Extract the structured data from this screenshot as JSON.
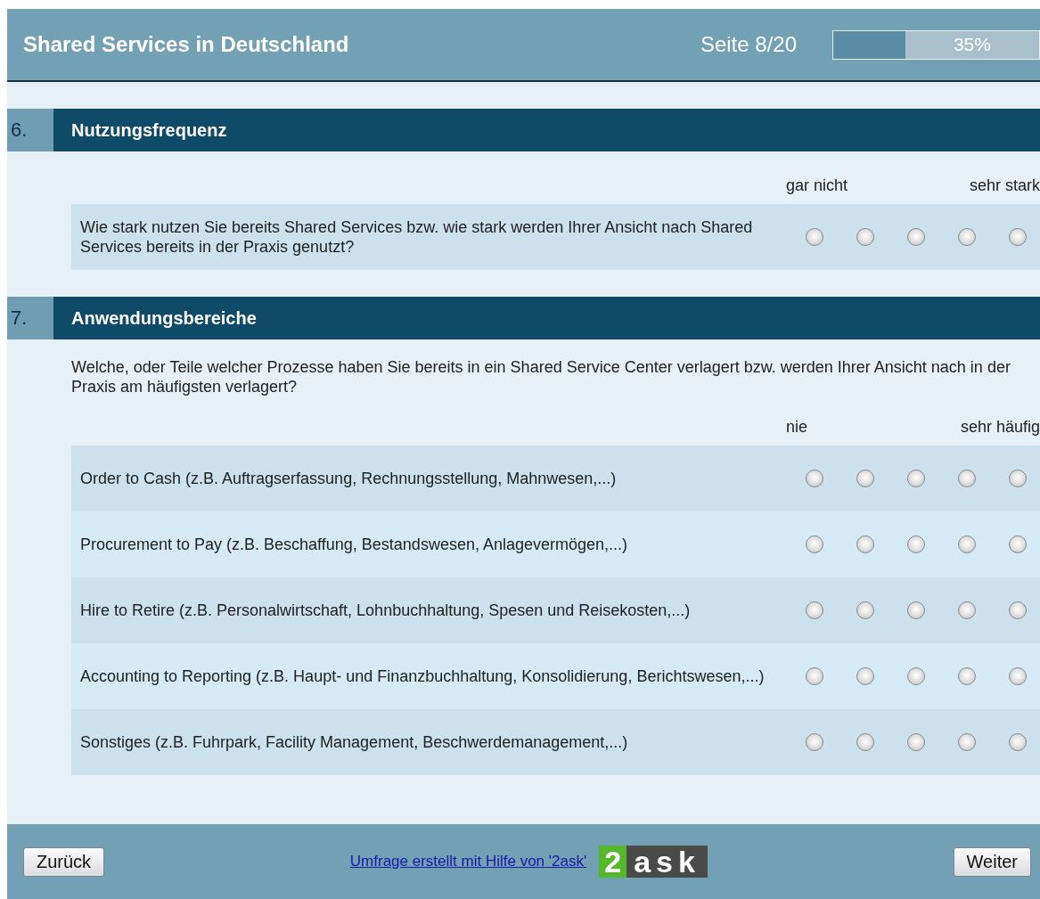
{
  "header": {
    "title": "Shared Services in Deutschland",
    "page": "Seite 8/20",
    "progress": {
      "level": 0.35,
      "reading": "35%"
    }
  },
  "sections": [
    {
      "number": "6.",
      "title": "Nutzungsfrequenz",
      "scale": {
        "low": "gar nicht",
        "high": "sehr stark"
      },
      "rows": [
        {
          "text": "Wie stark nutzen Sie bereits Shared Services bzw. wie stark werden Ihrer Ansicht nach Shared Services bereits in der Praxis genutzt?",
          "options": [
            {
              "selected": false
            },
            {
              "selected": false
            },
            {
              "selected": false
            },
            {
              "selected": false
            },
            {
              "selected": false
            }
          ]
        }
      ]
    },
    {
      "number": "7.",
      "title": "Anwendungsbereiche",
      "intro": "Welche, oder Teile welcher Prozesse haben Sie bereits in ein Shared Service Center verlagert bzw. werden Ihrer Ansicht nach in der Praxis am häufigsten verlagert?",
      "scale": {
        "low": "nie",
        "high": "sehr häufig"
      },
      "rows": [
        {
          "text": "Order to Cash (z.B. Auftragserfassung, Rechnungsstellung, Mahnwesen,...)",
          "options": [
            {
              "selected": false
            },
            {
              "selected": false
            },
            {
              "selected": false
            },
            {
              "selected": false
            },
            {
              "selected": false
            }
          ]
        },
        {
          "text": "Procurement to Pay (z.B. Beschaffung, Bestandswesen, Anlagevermögen,...)",
          "options": [
            {
              "selected": false
            },
            {
              "selected": false
            },
            {
              "selected": false
            },
            {
              "selected": false
            },
            {
              "selected": false
            }
          ]
        },
        {
          "text": "Hire to Retire (z.B. Personalwirtschaft, Lohnbuchhaltung, Spesen und Reisekosten,...)",
          "options": [
            {
              "selected": false
            },
            {
              "selected": false
            },
            {
              "selected": false
            },
            {
              "selected": false
            },
            {
              "selected": false
            }
          ]
        },
        {
          "text": "Accounting to Reporting (z.B. Haupt- und Finanzbuchhaltung, Konsolidierung, Berichtswesen,...)",
          "options": [
            {
              "selected": false
            },
            {
              "selected": false
            },
            {
              "selected": false
            },
            {
              "selected": false
            },
            {
              "selected": false
            }
          ]
        },
        {
          "text": "Sonstiges (z.B. Fuhrpark, Facility Management, Beschwerdemanagement,...)",
          "options": [
            {
              "selected": false
            },
            {
              "selected": false
            },
            {
              "selected": false
            },
            {
              "selected": false
            },
            {
              "selected": false
            }
          ]
        }
      ]
    }
  ],
  "footer": {
    "back": "Zurück",
    "link": "Umfrage erstellt mit Hilfe von '2ask'",
    "logo": {
      "digit": "2",
      "word": "ask"
    },
    "next": "Weiter"
  }
}
